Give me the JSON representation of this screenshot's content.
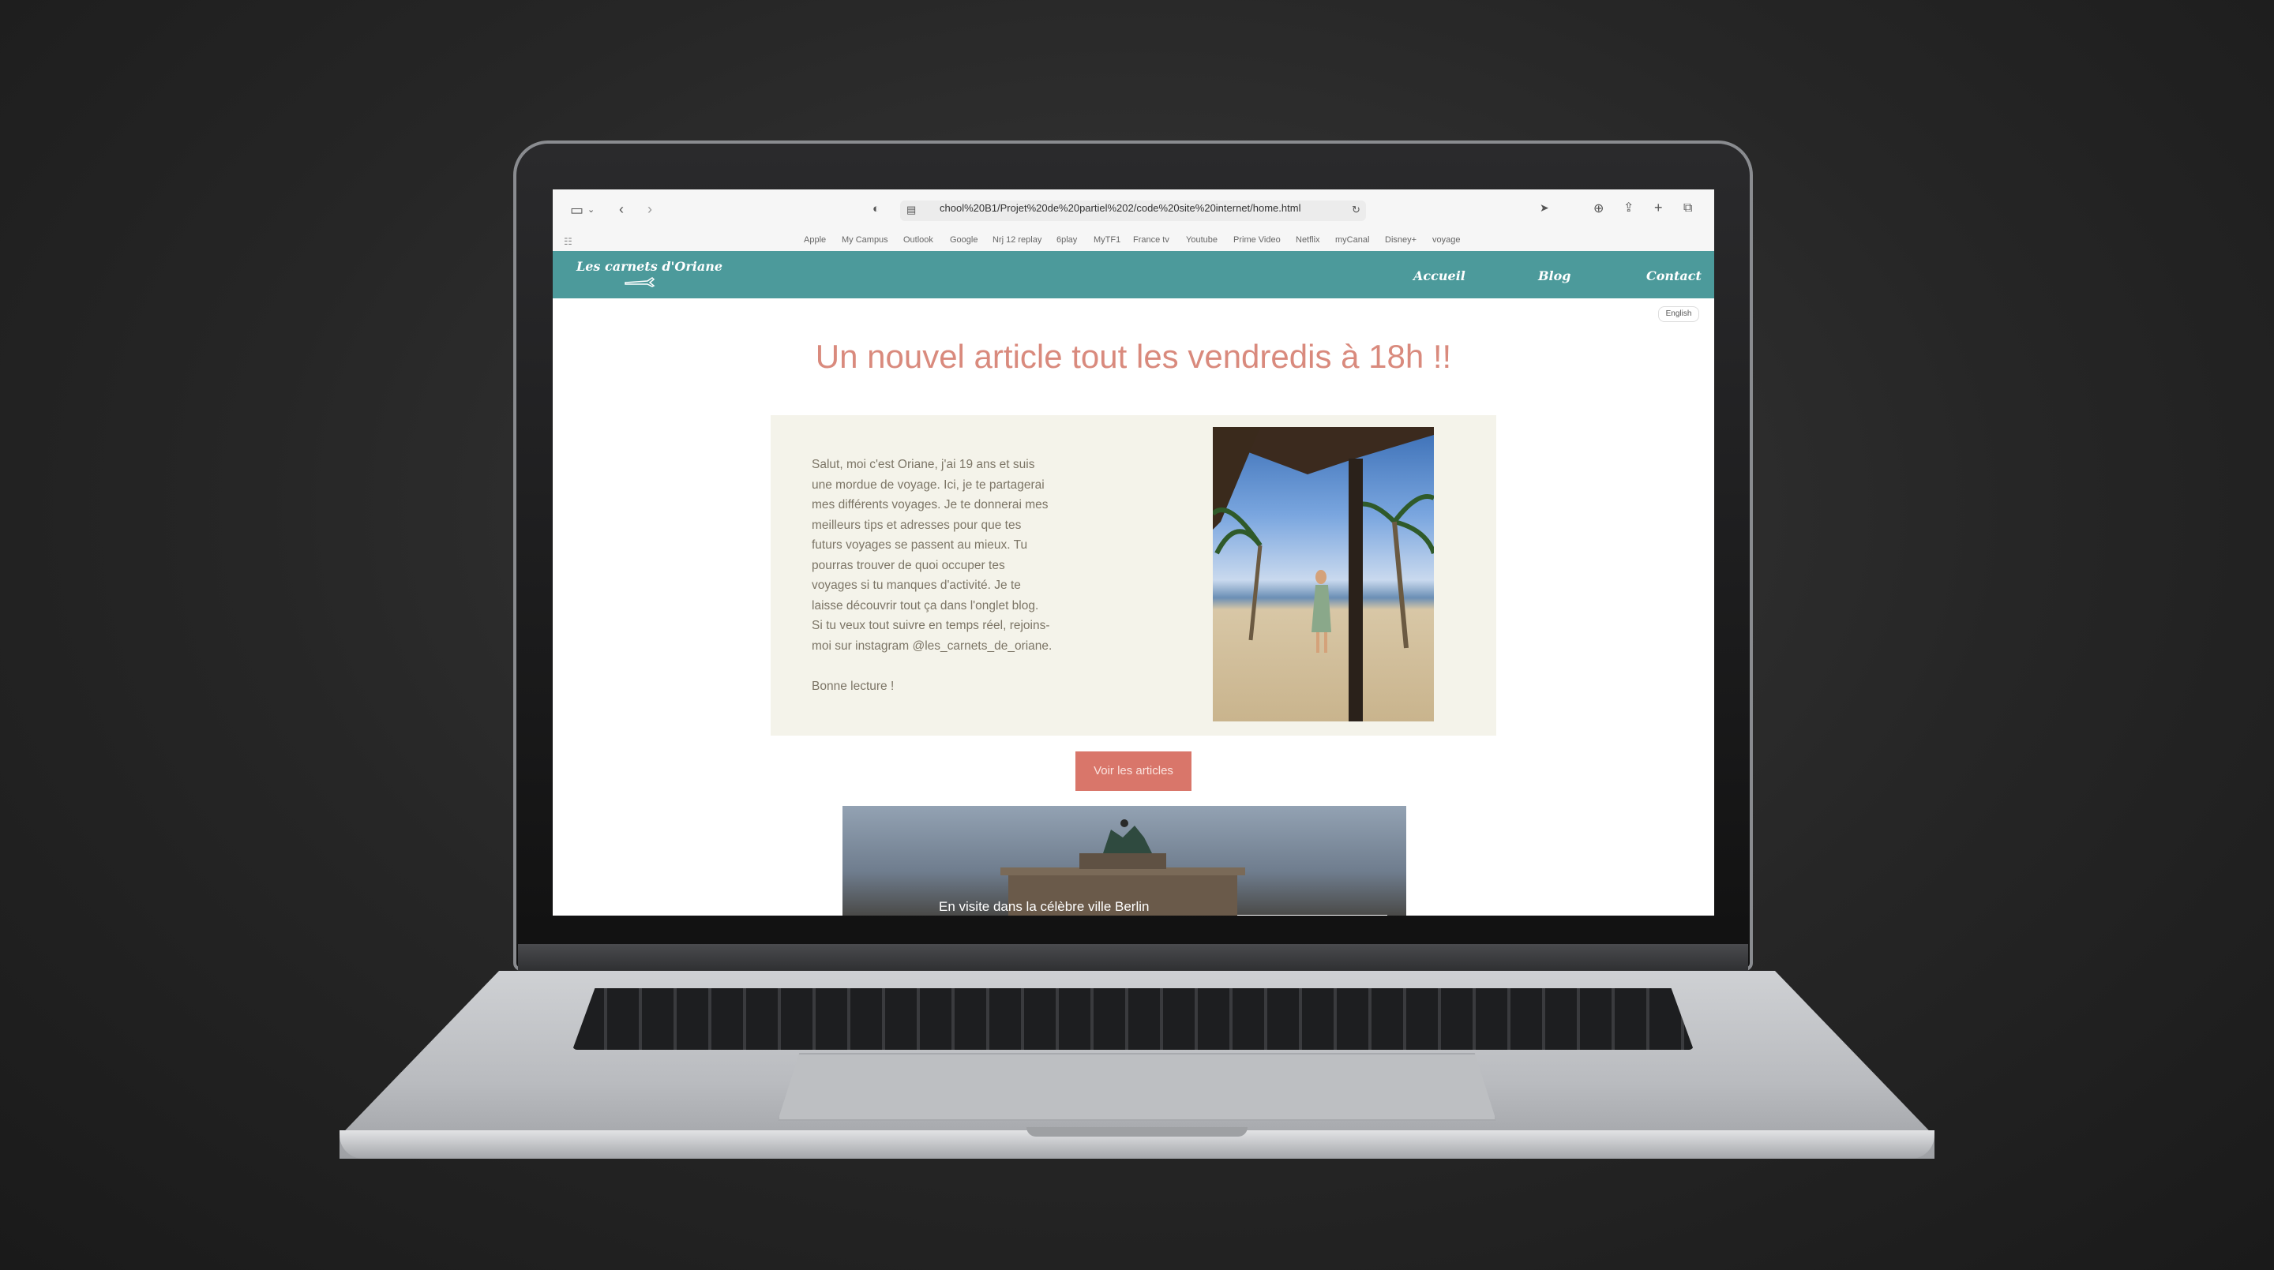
{
  "browser": {
    "url": "chool%20B1/Projet%20de%20partiel%202/code%20site%20internet/home.html",
    "bookmarks": [
      "Apple",
      "My Campus",
      "Outlook",
      "Google",
      "Nrj 12 replay",
      "6play",
      "MyTF1",
      "France tv",
      "Youtube",
      "Prime Video",
      "Netflix",
      "myCanal",
      "Disney+",
      "voyage"
    ]
  },
  "site": {
    "logo": "Les carnets d'Oriane",
    "nav": [
      "Accueil",
      "Blog",
      "Contact"
    ],
    "language_button": "English",
    "headline": "Un nouvel article tout les vendredis à 18h !!",
    "intro_lines": [
      "Salut, moi c'est Oriane, j'ai 19 ans et suis",
      "une mordue de voyage. Ici, je te partagerai",
      "mes différents voyages. Je te donnerai mes",
      "meilleurs tips et adresses pour que tes",
      "futurs voyages se passent au mieux. Tu",
      "pourras trouver de quoi occuper tes",
      "voyages si tu manques d'activité. Je te",
      "laisse découvrir tout ça dans l'onglet blog.",
      "Si tu veux tout suivre en temps réel, rejoins-",
      "moi sur instagram @les_carnets_de_oriane."
    ],
    "intro_sign": "Bonne lecture !",
    "cta_button": "Voir les articles",
    "banner_caption": "En visite dans la célèbre ville Berlin"
  },
  "colors": {
    "nav_bg": "#4c9a9b",
    "headline": "#d98a7d",
    "card_bg": "#f4f3ea",
    "cta_bg": "#d9766a"
  }
}
